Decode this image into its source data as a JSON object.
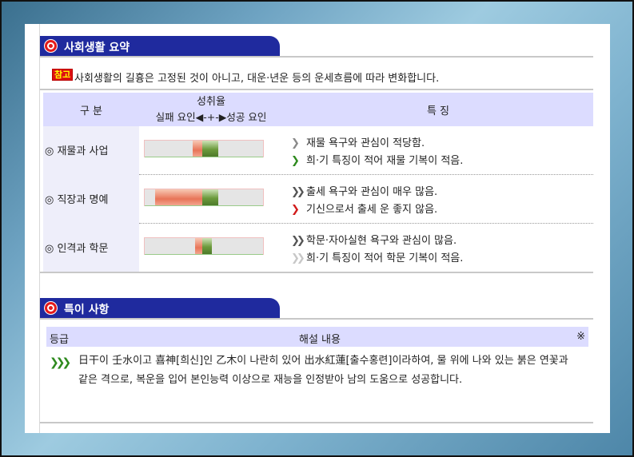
{
  "social": {
    "section_title": "사회생활 요약",
    "note_badge": "참고",
    "note_text": "사회생활의 길흉은 고정된 것이 아니고, 대운·년운 등의 운세흐름에 따라 변화합니다.",
    "headers": {
      "category": "구 분",
      "achievement": "성취율",
      "legend": "실패 요인◀-+-▶성공 요인",
      "features": "특 징"
    },
    "rows": [
      {
        "category": "◎ 재물과 사업",
        "fail": 0.08,
        "success": 0.13,
        "lines": [
          {
            "marker": "❯",
            "marker_color": "#8a8a8a",
            "text": "재물 욕구와 관심이 적당함."
          },
          {
            "marker": "❯",
            "marker_color": "#2e8a1e",
            "text": "희·기 특징이 적어 재물 기복이 적음."
          }
        ]
      },
      {
        "category": "◎ 직장과 명예",
        "fail": 0.39,
        "success": 0.13,
        "lines": [
          {
            "marker": "❯❯",
            "marker_color": "#555555",
            "text": "출세 욕구와 관심이 매우 많음."
          },
          {
            "marker": "❯",
            "marker_color": "#d11a1a",
            "text": "기신으로서 출세 운 좋지 않음."
          }
        ]
      },
      {
        "category": "◎ 인격과 학문",
        "fail": 0.06,
        "success": 0.08,
        "lines": [
          {
            "marker": "❯❯",
            "marker_color": "#555555",
            "text": "학문·자아실현 욕구와 관심이 많음."
          },
          {
            "marker": "❯❯",
            "marker_color": "#c8c8c8",
            "text": "희·기 특징이 적어 학문 기복이 적음."
          }
        ]
      }
    ]
  },
  "special": {
    "section_title": "특이 사항",
    "headers": {
      "grade": "등급",
      "content": "해설 내용",
      "mark": "※"
    },
    "marker": "❯❯❯",
    "text": "日干이 壬水이고 喜神[희신]인 乙木이 나란히 있어 出水紅蓮[출수홍련]이라하여, 물 위에 나와 있는 붉은 연꽃과 같은 격으로, 복운을 입어 본인능력 이상으로 재능을 인정받아 남의 도움으로 성공합니다."
  }
}
